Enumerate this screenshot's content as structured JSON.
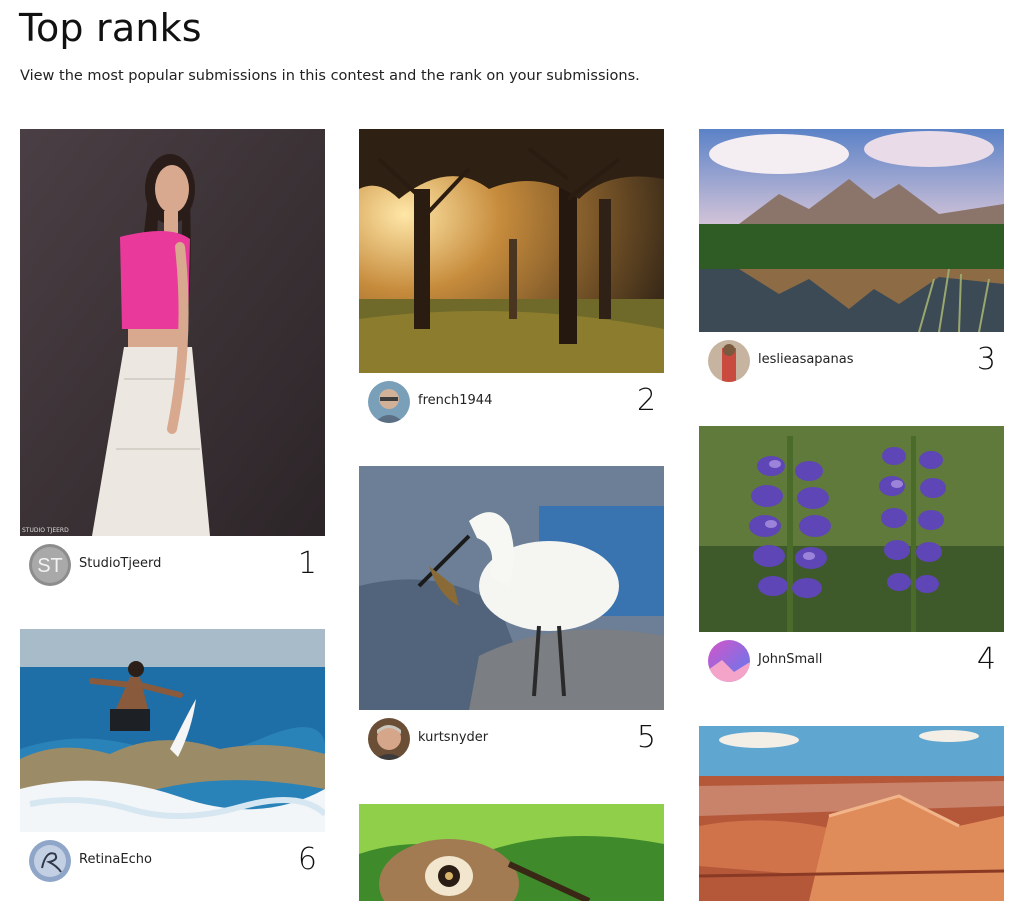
{
  "header": {
    "title": "Top ranks",
    "subtitle": "View the most popular submissions in this contest and the rank on your submissions."
  },
  "submissions": [
    {
      "username": "StudioTjeerd",
      "rank": "1",
      "avatar_text": "ST",
      "watermark": "STUDIO TJEERD"
    },
    {
      "username": "french1944",
      "rank": "2"
    },
    {
      "username": "leslieasapanas",
      "rank": "3"
    },
    {
      "username": "JohnSmall",
      "rank": "4"
    },
    {
      "username": "kurtsnyder",
      "rank": "5"
    },
    {
      "username": "RetinaEcho",
      "rank": "6"
    }
  ]
}
